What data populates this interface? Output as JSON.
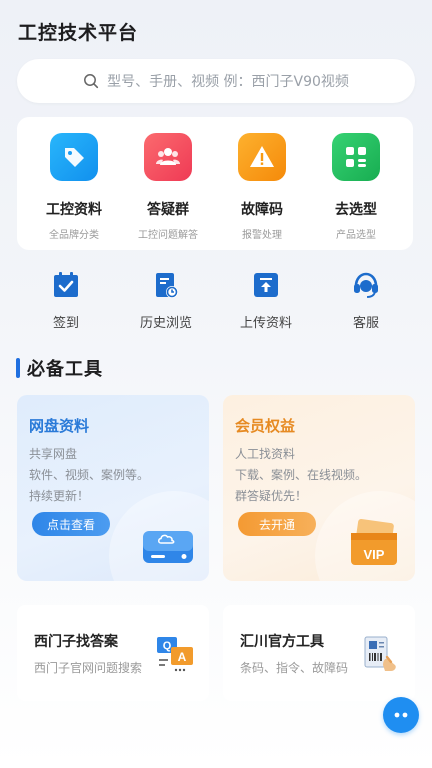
{
  "header": {
    "title": "工控技术平台"
  },
  "search": {
    "placeholder": "型号、手册、视频 例：西门子V90视频",
    "icon": "search-icon"
  },
  "main_menu": [
    {
      "label": "工控资料",
      "sub": "全品牌分类",
      "icon": "tag-icon",
      "color": "#1aa5f5"
    },
    {
      "label": "答疑群",
      "sub": "工控问题解答",
      "icon": "group-icon",
      "color": "#f14c5c"
    },
    {
      "label": "故障码",
      "sub": "报警处理",
      "icon": "warning-icon",
      "color": "#f79a12"
    },
    {
      "label": "去选型",
      "sub": "产品选型",
      "icon": "grid-icon",
      "color": "#22c15e"
    }
  ],
  "quick_menu": [
    {
      "label": "签到",
      "icon": "calendar-check-icon"
    },
    {
      "label": "历史浏览",
      "icon": "history-doc-icon"
    },
    {
      "label": "上传资料",
      "icon": "upload-icon"
    },
    {
      "label": "客服",
      "icon": "headset-icon"
    }
  ],
  "section": {
    "title": "必备工具"
  },
  "promos": {
    "disk": {
      "title": "网盘资料",
      "lines": [
        "共享网盘",
        "软件、视频、案例等。",
        "持续更新！"
      ],
      "button": "点击查看",
      "icon": "cloud-drive-icon",
      "accent": "#2a7ad8"
    },
    "vip": {
      "title": "会员权益",
      "lines": [
        "人工找资料",
        "下载、案例、在线视频。",
        "群答疑优先！"
      ],
      "button": "去开通",
      "icon": "vip-card-icon",
      "accent": "#e68a22"
    }
  },
  "tools": [
    {
      "title": "西门子找答案",
      "sub": "西门子官网问题搜索",
      "icon": "qa-chat-icon"
    },
    {
      "title": "汇川官方工具",
      "sub": "条码、指令、故障码",
      "icon": "barcode-doc-icon"
    }
  ],
  "fab": {
    "icon": "chat-bubble-icon"
  }
}
